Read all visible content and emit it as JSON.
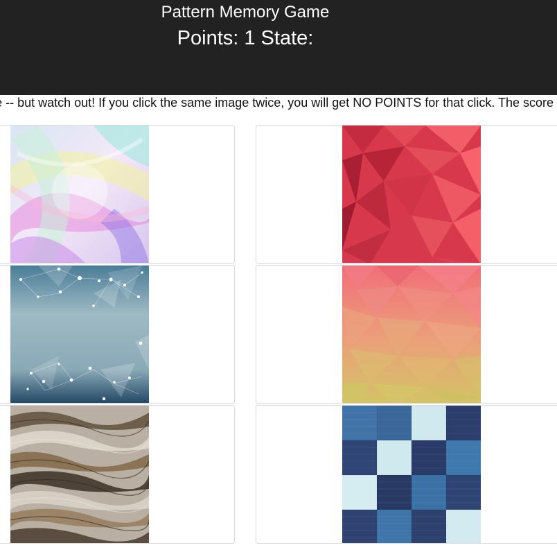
{
  "header": {
    "title": "Pattern Memory Game",
    "score_line": "Points: 1 State:"
  },
  "instructions": "Click an image to score -- but watch out! If you click the same image twice, you will get NO POINTS for that click. The score resets when you click a repeated image.",
  "cards": [
    {
      "image": "pastel-abstract-swirl-image",
      "colors": [
        "#f3c8f0",
        "#c9e6f2",
        "#f1f29a",
        "#e07bd7"
      ]
    },
    {
      "image": "red-polygon-image",
      "colors": [
        "#d8384b",
        "#f05d6a",
        "#b82a3c"
      ]
    },
    {
      "image": "blue-network-dots-image",
      "colors": [
        "#4a7d98",
        "#9fbac4",
        "#1f4563"
      ]
    },
    {
      "image": "coral-yellow-polygon-image",
      "colors": [
        "#f0707a",
        "#e8a877",
        "#d6c56a"
      ]
    },
    {
      "image": "marble-rock-strata-image",
      "colors": [
        "#8b7a64",
        "#cfc8bd",
        "#4d4339"
      ]
    },
    {
      "image": "denim-checkerboard-image",
      "colors": [
        "#3e6fa0",
        "#293b68",
        "#cfe9ef"
      ]
    }
  ]
}
